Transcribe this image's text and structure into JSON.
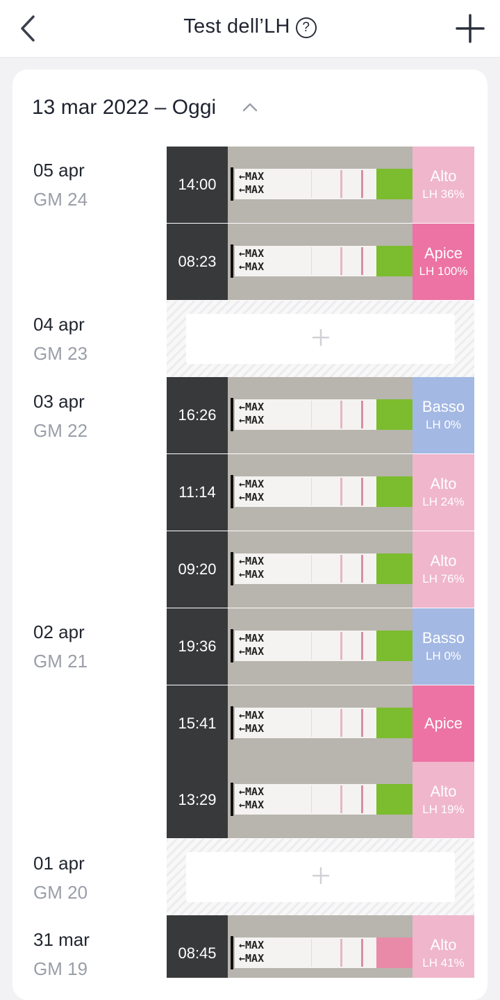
{
  "header": {
    "title": "Test dell’LH",
    "help_icon": "question-circle-icon",
    "back_icon": "chevron-left-icon",
    "add_icon": "plus-icon"
  },
  "range": {
    "label": "13 mar 2022 – Oggi",
    "toggle_icon": "chevron-up-icon"
  },
  "days": [
    {
      "date": "05 apr",
      "cycle_day": "GM 24"
    },
    {
      "date": "04 apr",
      "cycle_day": "GM 23"
    },
    {
      "date": "03 apr",
      "cycle_day": "GM 22"
    },
    {
      "date": "02 apr",
      "cycle_day": "GM 21"
    },
    {
      "date": "01 apr",
      "cycle_day": "GM 20"
    },
    {
      "date": "31 mar",
      "cycle_day": "GM 19"
    }
  ],
  "entries": [
    {
      "time": "14:00",
      "level": "Alto",
      "lh": "LH 36%"
    },
    {
      "time": "08:23",
      "level": "Apice",
      "lh": "LH 100%"
    },
    {
      "time": "16:26",
      "level": "Basso",
      "lh": "LH 0%"
    },
    {
      "time": "11:14",
      "level": "Alto",
      "lh": "LH 24%"
    },
    {
      "time": "09:20",
      "level": "Alto",
      "lh": "LH 76%"
    },
    {
      "time": "19:36",
      "level": "Basso",
      "lh": "LH 0%"
    },
    {
      "time": "15:41",
      "level": "Apice",
      "lh": ""
    },
    {
      "time": "13:29",
      "level": "Alto",
      "lh": "LH 19%"
    },
    {
      "time": "08:45",
      "level": "Alto",
      "lh": "LH 41%"
    }
  ],
  "strip_label": "← MAX\n← MAX",
  "colors": {
    "alto": "#efb6cc",
    "apice": "#ec73a3",
    "basso": "#a3b8e3",
    "time_bg": "#38393b",
    "strip_green": "#7bbd2e"
  }
}
